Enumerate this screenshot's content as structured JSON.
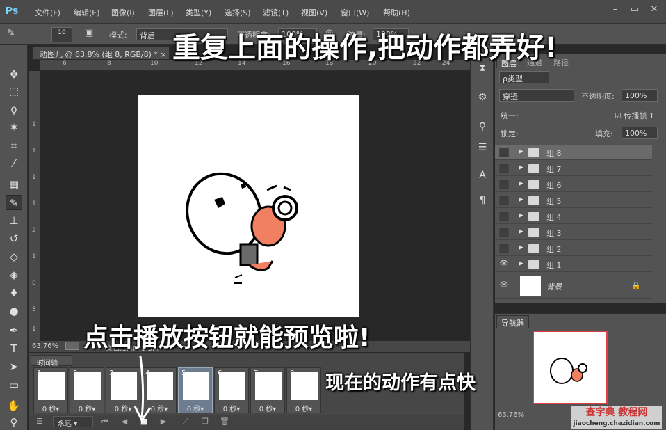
{
  "app": {
    "logo": "Ps",
    "menu": [
      "文件(F)",
      "编辑(E)",
      "图像(I)",
      "图层(L)",
      "类型(Y)",
      "选择(S)",
      "滤镜(T)",
      "视图(V)",
      "窗口(W)",
      "帮助(H)"
    ],
    "window_buttons": [
      "–",
      "▭",
      "✕"
    ]
  },
  "options": {
    "brush_size": "10",
    "mode_label": "模式:",
    "mode_value": "背后",
    "opacity_label": "不透明度:",
    "opacity_value": "100%",
    "flow_label": "流量:",
    "flow_value": "100%"
  },
  "document": {
    "tab": "动图儿 @ 63.8% (组 8, RGB/8) *",
    "tab_close": "×",
    "zoom": "63.76%",
    "docinfo": "文档:1.4M/1.5M"
  },
  "rulers": {
    "h": [
      "6",
      "8",
      "10",
      "12",
      "14",
      "16",
      "18",
      "20",
      "22",
      "24"
    ],
    "v": [
      "1",
      "1",
      "1",
      "1",
      "2",
      "1",
      "8",
      "8",
      "1",
      "0"
    ]
  },
  "timeline": {
    "tab": "时间轴",
    "frames": [
      {
        "num": "1",
        "dur": "0 秒▾"
      },
      {
        "num": "2",
        "dur": "0 秒▾"
      },
      {
        "num": "3",
        "dur": "0 秒▾"
      },
      {
        "num": "4",
        "dur": "0 秒▾"
      },
      {
        "num": "5",
        "dur": "0 秒▾"
      },
      {
        "num": "6",
        "dur": "0 秒▾"
      },
      {
        "num": "7",
        "dur": "0 秒▾"
      },
      {
        "num": "8",
        "dur": "0 秒▾"
      }
    ],
    "loop": "永远",
    "selected_frame": 5
  },
  "layers_panel": {
    "tabs": [
      "图层",
      "通道",
      "路径"
    ],
    "filter": "ρ类型",
    "blend": "穿透",
    "opacity_label": "不透明度:",
    "opacity_value": "100%",
    "unify_label": "统一:",
    "propagate_label": "传播帧",
    "propagate_val": "1",
    "lock_label": "锁定:",
    "fill_label": "填充:",
    "fill_value": "100%",
    "layers": [
      "组 8",
      "组 7",
      "组 6",
      "组 5",
      "组 4",
      "组 3",
      "组 2",
      "组 1"
    ],
    "background_layer": "背景"
  },
  "navigator": {
    "tab": "导航器",
    "zoom": "63.76%"
  },
  "annotations": {
    "top": "重复上面的操作,把动作都弄好!",
    "middle": "点击播放按钮就能预览啦!",
    "bottom": "现在的动作有点快"
  },
  "watermark": {
    "line1": "查字典 教程网",
    "line2": "jiaocheng.chazidian.com"
  },
  "colors": {
    "accent_red": "#e04040",
    "ps_blue": "#7bd6ff",
    "selected_frame": "#6d7c8e"
  }
}
